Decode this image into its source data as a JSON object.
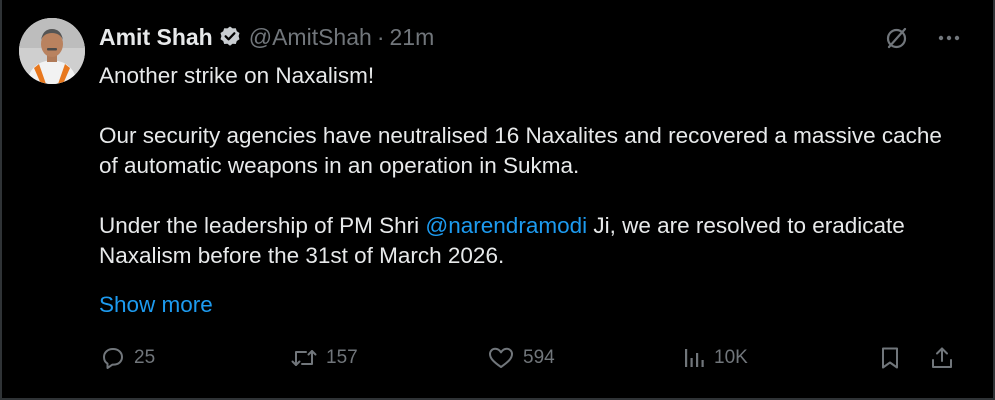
{
  "author": {
    "name": "Amit Shah",
    "handle": "@AmitShah",
    "separator": "·",
    "time": "21m"
  },
  "tweet": {
    "line1": "Another strike on Naxalism!",
    "para2": "Our security agencies have neutralised 16 Naxalites and recovered a massive cache of automatic weapons in an operation in Sukma.",
    "para3_before": "Under the leadership of PM Shri ",
    "para3_mention": "@narendramodi",
    "para3_after": " Ji, we are resolved to eradicate Naxalism before the 31st of March 2026.",
    "show_more": "Show more"
  },
  "stats": {
    "replies": "25",
    "reposts": "157",
    "likes": "594",
    "views": "10K"
  },
  "icons": {
    "top_right": [
      "grok-icon",
      "more-icon"
    ],
    "actions": [
      "reply-icon",
      "repost-icon",
      "like-icon",
      "views-icon",
      "bookmark-icon",
      "share-icon"
    ]
  },
  "colors": {
    "background": "#000000",
    "text": "#e7e9ea",
    "muted": "#71767b",
    "link": "#1d9bf0",
    "verified": "#c9cdd1"
  }
}
